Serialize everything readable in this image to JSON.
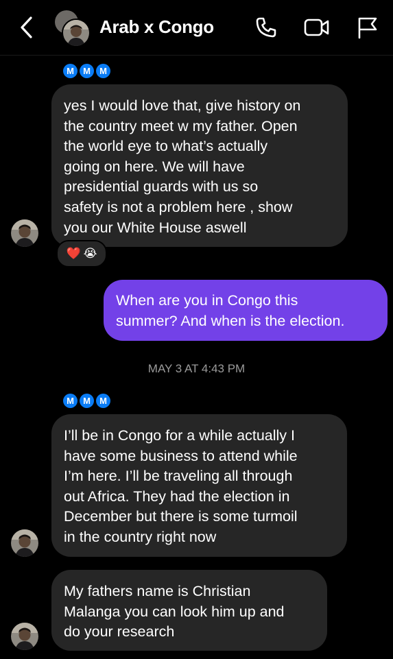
{
  "header": {
    "title": "Arab x Congo",
    "icons": [
      "back-chevron-icon",
      "phone-icon",
      "video-camera-icon",
      "flag-icon"
    ]
  },
  "messages": {
    "m1": {
      "seen_chips": [
        "M",
        "M",
        "M"
      ],
      "lines": [
        "yes I would love that, give history on",
        "the country meet w my father. Open",
        "the world eye to what’s actually",
        "going on here. We will have",
        "presidential guards with us so",
        "safety is not a problem here , show",
        "you our White House aswell"
      ],
      "reactions": [
        "❤️",
        "😭"
      ]
    },
    "m2": {
      "lines": [
        "When are you in Congo this",
        "summer? And when is the election."
      ]
    },
    "timestamp": "MAY 3 AT 4:43 PM",
    "m3": {
      "seen_chips": [
        "M",
        "M",
        "M"
      ],
      "lines": [
        "I’ll be in Congo for a while actually I",
        "have some business to attend while",
        "I’m here.  I’ll be traveling all through",
        "out Africa. They had the election in",
        "December but there is some turmoil",
        "in the country right now"
      ]
    },
    "m4": {
      "lines": [
        "My fathers name is Christian",
        "Malanga you can look him up and",
        "do your research"
      ]
    }
  },
  "colors": {
    "background": "#000000",
    "incoming_bubble": "#262626",
    "outgoing_bubble": "#7341e8",
    "seen_chip": "#0a7cf5",
    "timestamp": "#9b9b9b"
  }
}
